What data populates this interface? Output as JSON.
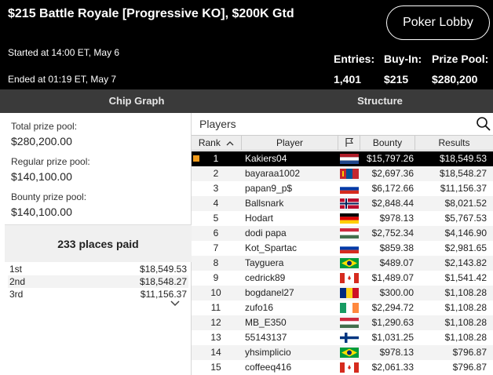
{
  "header": {
    "title": "$215 Battle Royale [Progressive KO], $200K Gtd",
    "lobby_button": "Poker Lobby",
    "started": "Started at 14:00 ET, May 6",
    "ended": "Ended at 01:19 ET, May 7",
    "entries_label": "Entries:",
    "entries_value": "1,401",
    "buyin_label": "Buy-In:",
    "buyin_value": "$215",
    "prizepool_label": "Prize Pool:",
    "prizepool_value": "$280,200"
  },
  "tabs": [
    "Chip Graph",
    "Structure"
  ],
  "prizes": {
    "total_label": "Total prize pool:",
    "total_value": "$280,200.00",
    "regular_label": "Regular prize pool:",
    "regular_value": "$140,100.00",
    "bounty_label": "Bounty prize pool:",
    "bounty_value": "$140,100.00",
    "places_paid": "233 places paid",
    "places": [
      {
        "place": "1st",
        "amount": "$18,549.53"
      },
      {
        "place": "2nd",
        "amount": "$18,548.27"
      },
      {
        "place": "3rd",
        "amount": "$11,156.37"
      }
    ]
  },
  "players": {
    "title": "Players",
    "columns": {
      "rank": "Rank",
      "player": "Player",
      "bounty": "Bounty",
      "results": "Results"
    },
    "icons": {
      "sort": "chevron-up-icon",
      "flag_column": "flag-icon",
      "search": "search-icon",
      "expand": "chevron-down-icon"
    },
    "selected_row_marker_color": "#f29b1b",
    "rows": [
      {
        "rank": "1",
        "player": "Kakiers04",
        "flag": "netherlands",
        "bounty": "$15,797.26",
        "results": "$18,549.53"
      },
      {
        "rank": "2",
        "player": "bayaraa1002",
        "flag": "mongolia",
        "bounty": "$2,697.36",
        "results": "$18,548.27"
      },
      {
        "rank": "3",
        "player": "papan9_p$",
        "flag": "russia",
        "bounty": "$6,172.66",
        "results": "$11,156.37"
      },
      {
        "rank": "4",
        "player": "Ballsnark",
        "flag": "norway",
        "bounty": "$2,848.44",
        "results": "$8,021.52"
      },
      {
        "rank": "5",
        "player": "Hodart",
        "flag": "germany",
        "bounty": "$978.13",
        "results": "$5,767.53"
      },
      {
        "rank": "6",
        "player": "dodi papa",
        "flag": "hungary",
        "bounty": "$2,752.34",
        "results": "$4,146.90"
      },
      {
        "rank": "7",
        "player": "Kot_Spartac",
        "flag": "russia",
        "bounty": "$859.38",
        "results": "$2,981.65"
      },
      {
        "rank": "8",
        "player": "Tayguera",
        "flag": "brazil",
        "bounty": "$489.07",
        "results": "$2,143.82"
      },
      {
        "rank": "9",
        "player": "cedrick89",
        "flag": "canada",
        "bounty": "$1,489.07",
        "results": "$1,541.42"
      },
      {
        "rank": "10",
        "player": "bogdanel27",
        "flag": "romania",
        "bounty": "$300.00",
        "results": "$1,108.28"
      },
      {
        "rank": "11",
        "player": "zufo16",
        "flag": "ireland",
        "bounty": "$2,294.72",
        "results": "$1,108.28"
      },
      {
        "rank": "12",
        "player": "MB_E350",
        "flag": "hungary",
        "bounty": "$1,290.63",
        "results": "$1,108.28"
      },
      {
        "rank": "13",
        "player": "55143137",
        "flag": "finland",
        "bounty": "$1,031.25",
        "results": "$1,108.28"
      },
      {
        "rank": "14",
        "player": "yhsimplicio",
        "flag": "brazil",
        "bounty": "$978.13",
        "results": "$796.87"
      },
      {
        "rank": "15",
        "player": "coffeeq416",
        "flag": "canada",
        "bounty": "$2,061.33",
        "results": "$796.87"
      }
    ]
  }
}
